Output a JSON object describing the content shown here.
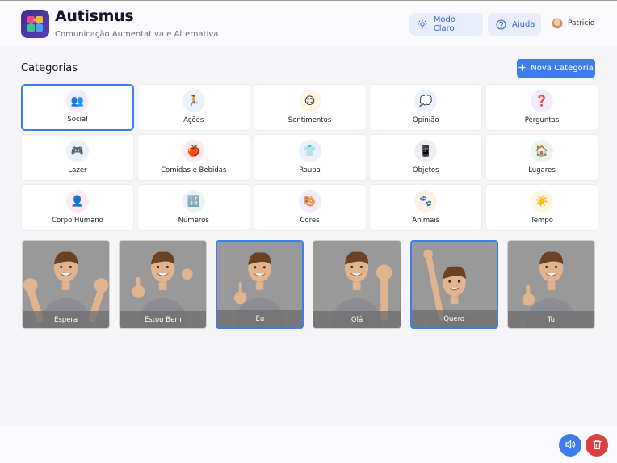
{
  "header": {
    "title": "Autismus",
    "subtitle": "Comunicação Aumentativa e Alternativa",
    "theme_button": "Modo Claro",
    "help_button": "Ajuda",
    "user_name": "Patricio"
  },
  "categories": {
    "title": "Categorias",
    "new_button": "Nova Categoria",
    "items": [
      {
        "label": "Social",
        "icon": "people-icon",
        "glyph": "👥",
        "bg": "#f3eafd",
        "selected": true
      },
      {
        "label": "Ações",
        "icon": "running-person-icon",
        "glyph": "🏃",
        "bg": "#e9f1fd"
      },
      {
        "label": "Sentimentos",
        "icon": "smiley-icon",
        "glyph": "😊",
        "bg": "#fdf6e4"
      },
      {
        "label": "Opinião",
        "icon": "thought-bubble-icon",
        "glyph": "💭",
        "bg": "#e9f1fd"
      },
      {
        "label": "Perguntas",
        "icon": "question-mark-icon",
        "glyph": "❓",
        "bg": "#f3eafd"
      },
      {
        "label": "Lazer",
        "icon": "gamepad-icon",
        "glyph": "🎮",
        "bg": "#e9f1fd"
      },
      {
        "label": "Comidas e Bebidas",
        "icon": "apple-icon",
        "glyph": "🍎",
        "bg": "#fdebeb"
      },
      {
        "label": "Roupa",
        "icon": "shirt-icon",
        "glyph": "👕",
        "bg": "#e9f1fd"
      },
      {
        "label": "Objetos",
        "icon": "phone-icon",
        "glyph": "📱",
        "bg": "#eeeef2"
      },
      {
        "label": "Lugares",
        "icon": "house-icon",
        "glyph": "🏠",
        "bg": "#eaf6ec"
      },
      {
        "label": "Corpo Humano",
        "icon": "person-bust-icon",
        "glyph": "👤",
        "bg": "#fdebf0"
      },
      {
        "label": "Números",
        "icon": "numbers-icon",
        "glyph": "🔢",
        "bg": "#e8f4f6"
      },
      {
        "label": "Cores",
        "icon": "palette-icon",
        "glyph": "🎨",
        "bg": "#f3eafd"
      },
      {
        "label": "Animais",
        "icon": "paw-icon",
        "glyph": "🐾",
        "bg": "#fdf1e6"
      },
      {
        "label": "Tempo",
        "icon": "sun-icon",
        "glyph": "☀️",
        "bg": "#fdf6e4"
      }
    ]
  },
  "cards": [
    {
      "label": "Espera",
      "gesture": "both-hands-open",
      "selected": false
    },
    {
      "label": "Estou Bem",
      "gesture": "thumbs-up",
      "selected": false
    },
    {
      "label": "Eu",
      "gesture": "point-self",
      "selected": true
    },
    {
      "label": "Olá",
      "gesture": "wave",
      "selected": false
    },
    {
      "label": "Quero",
      "gesture": "hand-raised",
      "selected": true
    },
    {
      "label": "Tu",
      "gesture": "thumbs-up-single",
      "selected": false
    }
  ],
  "actions": {
    "speak_icon": "speaker-icon",
    "delete_icon": "trash-icon"
  },
  "colors": {
    "accent": "#3d7df0",
    "danger": "#dc3f3f"
  }
}
